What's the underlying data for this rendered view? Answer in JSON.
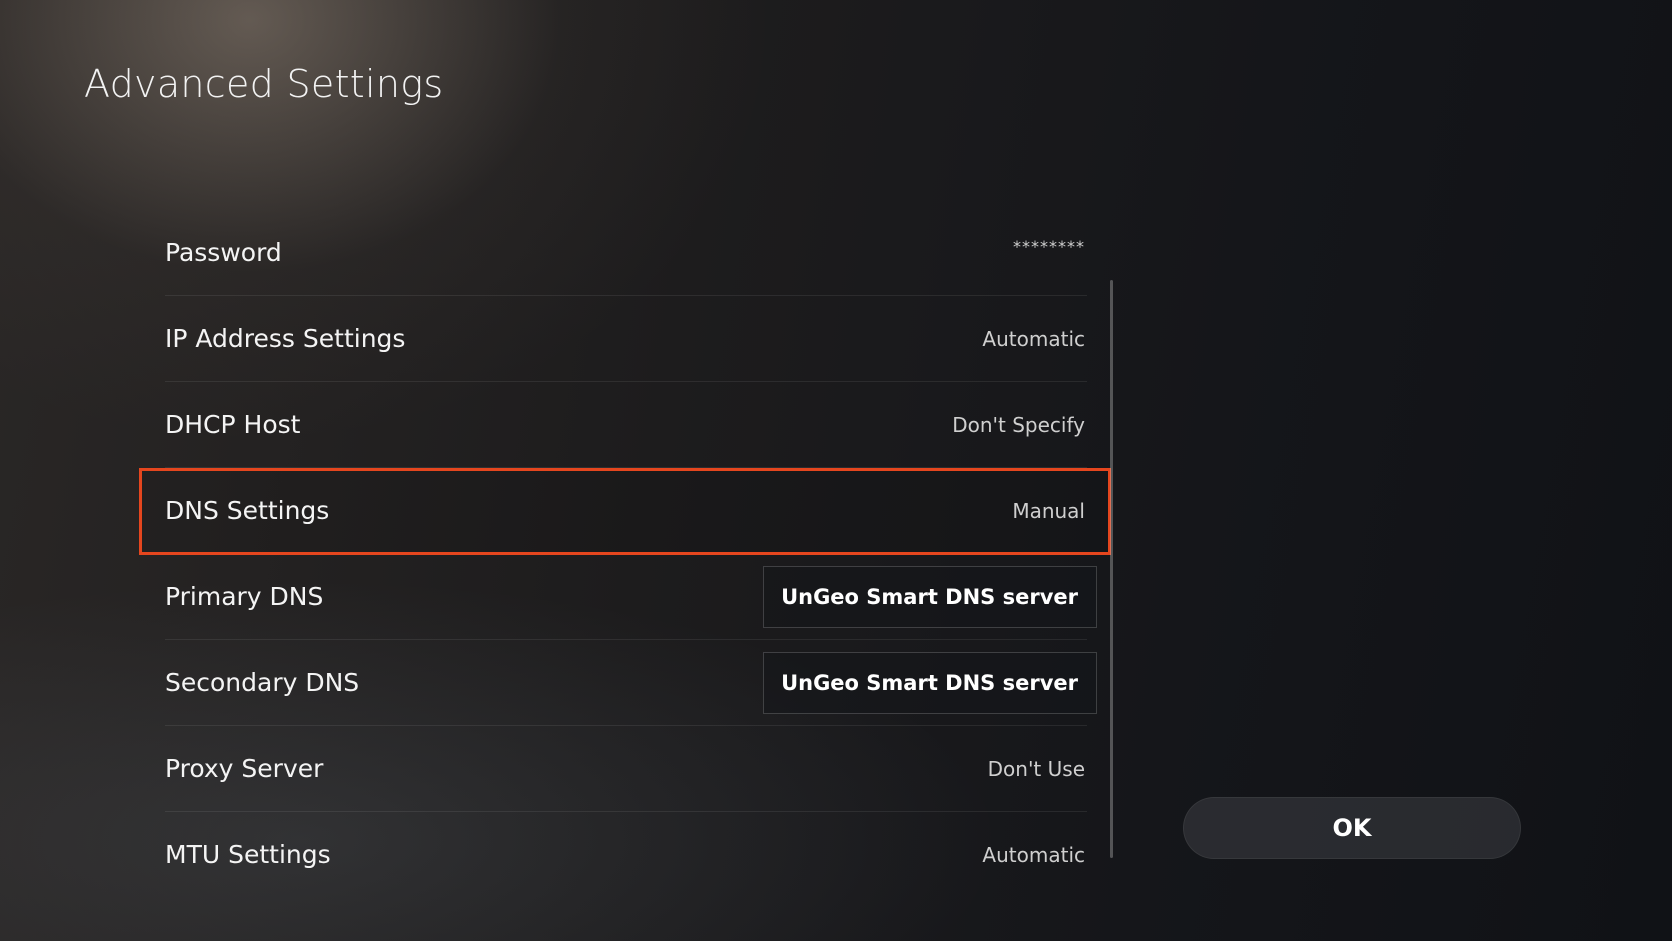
{
  "page": {
    "title": "Advanced Settings"
  },
  "settings": {
    "items": [
      {
        "label": "Password",
        "value": "********"
      },
      {
        "label": "IP Address Settings",
        "value": "Automatic"
      },
      {
        "label": "DHCP Host",
        "value": "Don't Specify"
      },
      {
        "label": "DNS Settings",
        "value": "Manual",
        "focused": true
      },
      {
        "label": "Primary DNS",
        "value": "UnGeo Smart DNS server"
      },
      {
        "label": "Secondary DNS",
        "value": "UnGeo Smart DNS server"
      },
      {
        "label": "Proxy Server",
        "value": "Don't Use"
      },
      {
        "label": "MTU Settings",
        "value": "Automatic"
      }
    ]
  },
  "actions": {
    "ok_label": "OK"
  },
  "colors": {
    "focus_border": "#e5461e"
  }
}
